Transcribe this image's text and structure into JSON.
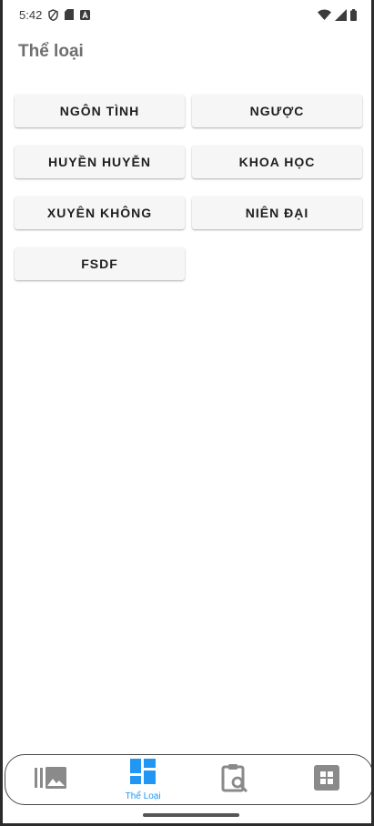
{
  "status_bar": {
    "time": "5:42",
    "left_icons": [
      "shield-icon",
      "sd-card-icon",
      "font-a-icon"
    ],
    "right_icons": [
      "wifi-icon",
      "signal-icon",
      "battery-icon"
    ]
  },
  "page": {
    "title": "Thể loại"
  },
  "genres": [
    "NGÔN TÌNH",
    "NGƯỢC",
    "HUYỀN HUYỄN",
    "KHOA HỌC",
    "XUYÊN KHÔNG",
    "NIÊN ĐẠI",
    "FSDF"
  ],
  "bottom_nav": {
    "items": [
      {
        "icon": "library-icon",
        "label": "",
        "active": false
      },
      {
        "icon": "dashboard-icon",
        "label": "Thể Loại",
        "active": true
      },
      {
        "icon": "clipboard-search-icon",
        "label": "",
        "active": false
      },
      {
        "icon": "apps-grid-icon",
        "label": "",
        "active": false
      }
    ]
  },
  "colors": {
    "accent": "#2196f3",
    "inactive_icon": "#8a8a8a",
    "button_bg": "#f6f6f6"
  }
}
